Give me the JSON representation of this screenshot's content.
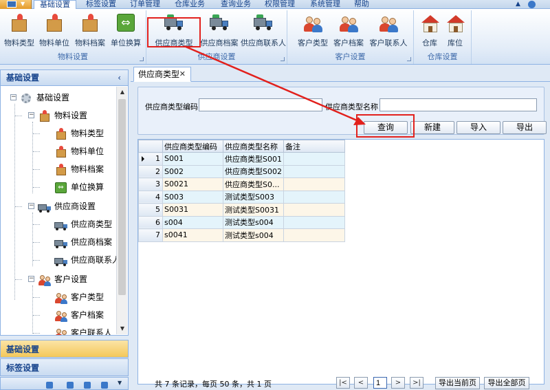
{
  "menubar": {
    "tabs": [
      {
        "label": "基础设置",
        "active": true
      },
      {
        "label": "标签设置"
      },
      {
        "label": "订单管理"
      },
      {
        "label": "仓库业务"
      },
      {
        "label": "查询业务"
      },
      {
        "label": "权限管理"
      },
      {
        "label": "系统管理"
      },
      {
        "label": "帮助"
      }
    ]
  },
  "ribbon": {
    "groups": [
      {
        "label": "物料设置",
        "items": [
          {
            "label": "物料类型",
            "icon": "box-icon"
          },
          {
            "label": "物料单位",
            "icon": "box-icon"
          },
          {
            "label": "物料档案",
            "icon": "box-icon"
          },
          {
            "label": "单位换算",
            "icon": "swap-icon"
          }
        ]
      },
      {
        "label": "供应商设置",
        "items": [
          {
            "label": "供应商类型",
            "icon": "truck-icon"
          },
          {
            "label": "供应商档案",
            "icon": "truck-icon"
          },
          {
            "label": "供应商联系人",
            "icon": "truck-icon"
          }
        ]
      },
      {
        "label": "客户设置",
        "items": [
          {
            "label": "客户类型",
            "icon": "people-icon"
          },
          {
            "label": "客户档案",
            "icon": "people-icon"
          },
          {
            "label": "客户联系人",
            "icon": "people-icon"
          }
        ]
      },
      {
        "label": "仓库设置",
        "items": [
          {
            "label": "仓库",
            "icon": "house-icon"
          },
          {
            "label": "库位",
            "icon": "house-icon"
          }
        ]
      }
    ]
  },
  "nav": {
    "header": "基础设置",
    "collapse_glyph": "‹",
    "tree": {
      "root": "基础设置",
      "groups": [
        {
          "label": "物料设置",
          "children": [
            "物料类型",
            "物料单位",
            "物料档案",
            "单位换算"
          ]
        },
        {
          "label": "供应商设置",
          "children": [
            "供应商类型",
            "供应商档案",
            "供应商联系人"
          ]
        },
        {
          "label": "客户设置",
          "children": [
            "客户类型",
            "客户档案",
            "客户联系人"
          ]
        }
      ]
    },
    "sections": [
      {
        "label": "基础设置",
        "selected": true
      },
      {
        "label": "标签设置",
        "selected": false
      }
    ]
  },
  "document": {
    "tab_label": "供应商类型",
    "tab_close": "✕",
    "filter": {
      "code_label": "供应商类型编码",
      "code_value": "",
      "name_label": "供应商类型名称",
      "name_value": ""
    },
    "actions": {
      "query": "查询",
      "new": "新建",
      "import": "导入",
      "export": "导出"
    },
    "grid": {
      "columns": [
        "供应商类型编码",
        "供应商类型名称",
        "备注"
      ],
      "rows": [
        {
          "num": "1",
          "code": "S001",
          "name": "供应商类型S001",
          "note": ""
        },
        {
          "num": "2",
          "code": "S002",
          "name": "供应商类型S002",
          "note": ""
        },
        {
          "num": "3",
          "code": "S0021",
          "name": "供应商类型S0...",
          "note": ""
        },
        {
          "num": "4",
          "code": "S003",
          "name": "测试类型S003",
          "note": ""
        },
        {
          "num": "5",
          "code": "S0031",
          "name": "测试类型S0031",
          "note": ""
        },
        {
          "num": "6",
          "code": "s004",
          "name": "测试类型s004",
          "note": ""
        },
        {
          "num": "7",
          "code": "s0041",
          "name": "测试类型s004",
          "note": ""
        }
      ]
    },
    "pager": {
      "summary": "共 7 条记录，每页 50 条，共 1 页",
      "first": "|<",
      "prev": "<",
      "page": "1",
      "next": ">",
      "last": ">|",
      "export_current": "导出当前页",
      "export_all": "导出全部页"
    }
  },
  "colors": {
    "highlight_red": "#e2201c",
    "accent_blue": "#15428b"
  }
}
